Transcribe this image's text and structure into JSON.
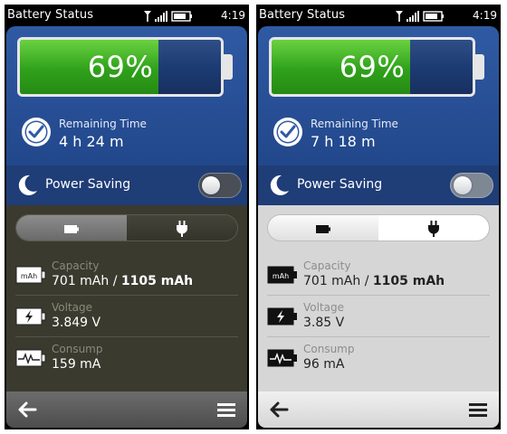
{
  "panels": [
    {
      "theme": "dark",
      "status_bar": {
        "title": "Battery Status",
        "time": "4:19"
      },
      "battery": {
        "percent_text": "69%",
        "level": 0.69
      },
      "remaining": {
        "label": "Remaining Time",
        "value": "4 h 24 m",
        "icon": "clock-check-icon"
      },
      "power_saving": {
        "label": "Power Saving",
        "enabled": false
      },
      "tabs": {
        "left_icon": "battery-icon",
        "right_icon": "plug-icon",
        "selected": "left"
      },
      "capacity": {
        "label": "Capacity",
        "current": "701 mAh",
        "separator": " / ",
        "total": "1105 mAh",
        "icon": "mah-battery-icon"
      },
      "voltage": {
        "label": "Voltage",
        "value": "3.849 V",
        "icon": "voltage-battery-icon"
      },
      "consump": {
        "label": "Consump",
        "value": "159 mA",
        "icon": "pulse-battery-icon"
      },
      "toolbar": {
        "back_icon": "back-arrow-icon",
        "menu_icon": "menu-icon"
      }
    },
    {
      "theme": "light",
      "status_bar": {
        "title": "Battery Status",
        "time": "4:19"
      },
      "battery": {
        "percent_text": "69%",
        "level": 0.69
      },
      "remaining": {
        "label": "Remaining Time",
        "value": "7 h 18 m",
        "icon": "clock-check-icon"
      },
      "power_saving": {
        "label": "Power Saving",
        "enabled": false
      },
      "tabs": {
        "left_icon": "battery-icon",
        "right_icon": "plug-icon",
        "selected": "right"
      },
      "capacity": {
        "label": "Capacity",
        "current": "701 mAh",
        "separator": " / ",
        "total": "1105 mAh",
        "icon": "mah-battery-icon"
      },
      "voltage": {
        "label": "Voltage",
        "value": "3.85 V",
        "icon": "voltage-battery-icon"
      },
      "consump": {
        "label": "Consump",
        "value": "96 mA",
        "icon": "pulse-battery-icon"
      },
      "toolbar": {
        "back_icon": "back-arrow-icon",
        "menu_icon": "menu-icon"
      }
    }
  ],
  "colors": {
    "header_blue": "#2f5aa3",
    "battery_green": "#2fa11b",
    "dark_panel_bg": "#3b3a2f",
    "light_panel_bg": "#d6d6d6"
  }
}
